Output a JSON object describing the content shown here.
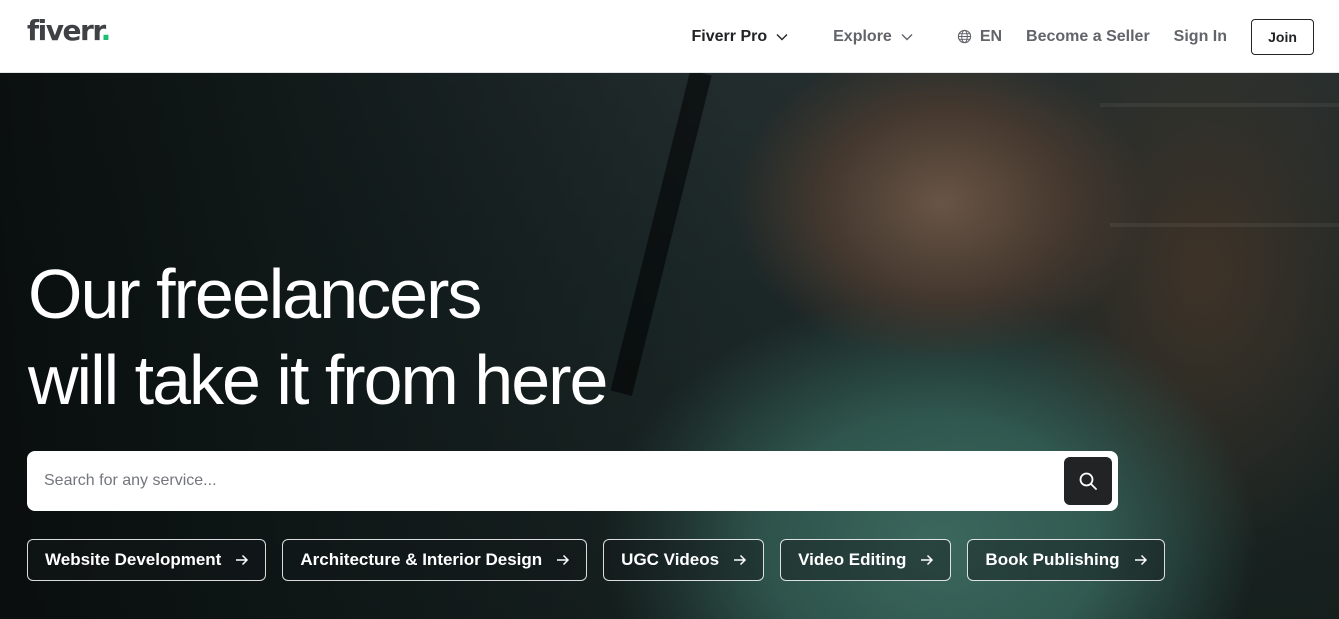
{
  "brand": {
    "name": "fiverr",
    "dot": ".",
    "accent_color": "#1dbf73"
  },
  "nav": {
    "pro_label": "Fiverr Pro",
    "explore_label": "Explore",
    "language_label": "EN",
    "become_seller_label": "Become a Seller",
    "sign_in_label": "Sign In",
    "join_label": "Join"
  },
  "hero": {
    "headline_line1": "Our freelancers",
    "headline_line2": "will take it from here",
    "search": {
      "placeholder": "Search for any service...",
      "value": ""
    },
    "chips": [
      {
        "label": "Website Development"
      },
      {
        "label": "Architecture & Interior Design"
      },
      {
        "label": "UGC Videos"
      },
      {
        "label": "Video Editing"
      },
      {
        "label": "Book Publishing"
      }
    ]
  },
  "icons": {
    "dropdown": "chevron-down-icon",
    "language": "globe-icon",
    "search": "search-icon",
    "chip_arrow": "arrow-right-icon"
  }
}
